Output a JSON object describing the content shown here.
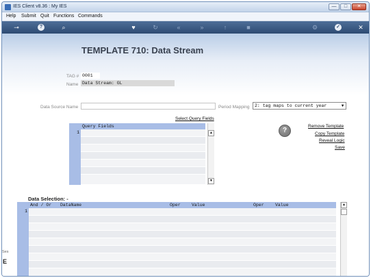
{
  "window": {
    "title": "IES Client v8.36 : My IES",
    "buttons": {
      "minimize": "—",
      "maximize": "□",
      "close": "✕"
    }
  },
  "menu": [
    "Help",
    "Submit",
    "Quit",
    "Functions",
    "Commands"
  ],
  "toolbar": {
    "icons": [
      "key-icon",
      "help-icon",
      "search-icon",
      "heart-icon",
      "refresh-icon",
      "rewind-icon",
      "fast-forward-icon",
      "upload-icon",
      "stop-icon",
      "settings-icon",
      "check-icon",
      "close-icon"
    ]
  },
  "page": {
    "title": "TEMPLATE 710: Data Stream",
    "tag_label": "TAG #",
    "tag_value": "0001",
    "name_label": "Name",
    "name_value": "Data Stream: GL",
    "data_source_label": "Data Source Name",
    "data_source_value": "",
    "period_mapping_label": "Period Mapping",
    "period_mapping_value": "2: tag maps to current year",
    "select_query_fields_link": "Select Query Fields"
  },
  "query_fields": {
    "header": "Query Fields",
    "row_numbers": [
      "1"
    ]
  },
  "actions": {
    "remove_template": "Remove Template",
    "copy_template": "Copy Template",
    "reveal_logic": "Reveal Logic",
    "save": "Save"
  },
  "data_selection": {
    "title": "Data Selection: -",
    "columns": [
      "And / Or",
      "DataName",
      "Oper",
      "Value",
      "Oper",
      "Value"
    ],
    "row_numbers": [
      "1"
    ]
  },
  "side": {
    "label_top": "Ses",
    "label_bottom": "E"
  },
  "colors": {
    "toolbar": "#2d4a72",
    "grid_header": "#a8bde6",
    "page_bg_top": "#b9cde7"
  }
}
